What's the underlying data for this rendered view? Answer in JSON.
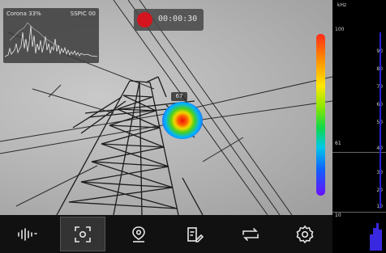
{
  "waveform": {
    "left_text": "Corona  33%",
    "right_text": "SSPIC 00"
  },
  "recording": {
    "timer": "00:00:30"
  },
  "detection": {
    "label": "67"
  },
  "colors": {
    "record_red": "#d4141e",
    "toolbar_bg": "#111111",
    "accent_blue": "#2a1fd8"
  },
  "toolbar": {
    "items": [
      {
        "name": "audio",
        "icon": "audio-wave-icon"
      },
      {
        "name": "capture",
        "icon": "capture-focus-icon",
        "active": true
      },
      {
        "name": "location",
        "icon": "location-pin-icon"
      },
      {
        "name": "report",
        "icon": "edit-report-icon"
      },
      {
        "name": "switch",
        "icon": "swap-arrows-icon"
      },
      {
        "name": "settings",
        "icon": "gear-icon"
      }
    ]
  },
  "side_panel": {
    "header": "kHz",
    "top_label": "100",
    "upper_labels": [
      "90",
      "80",
      "70",
      "60",
      "50",
      "40"
    ],
    "marker_left": "61",
    "lower_labels": [
      "30",
      "20",
      "10"
    ],
    "bottom_label": "10"
  }
}
